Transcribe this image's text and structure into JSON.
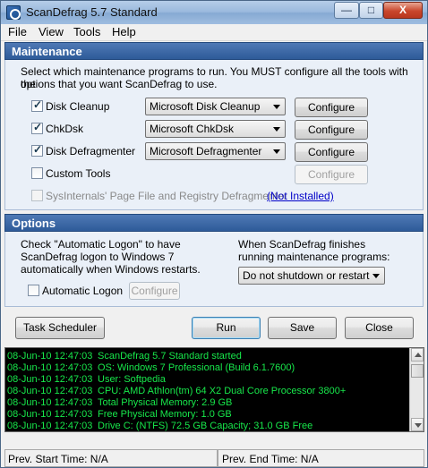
{
  "window": {
    "title": "ScanDefrag 5.7 Standard",
    "controls": {
      "minimize": "—",
      "maximize": "□",
      "close": "X"
    }
  },
  "menu": [
    "File",
    "View",
    "Tools",
    "Help"
  ],
  "maintenance": {
    "header": "Maintenance",
    "description_line1": "Select which maintenance programs to run.  You MUST configure all the tools with the",
    "description_line2": "options that you want ScanDefrag to use.",
    "tools": [
      {
        "label": "Disk Cleanup",
        "checked": true,
        "program": "Microsoft Disk Cleanup",
        "configure": "Configure"
      },
      {
        "label": "ChkDsk",
        "checked": true,
        "program": "Microsoft ChkDsk",
        "configure": "Configure"
      },
      {
        "label": "Disk Defragmenter",
        "checked": true,
        "program": "Microsoft Defragmenter",
        "configure": "Configure"
      },
      {
        "label": "Custom Tools",
        "checked": false,
        "configure": "Configure"
      }
    ],
    "sysinternals_label": "SysInternals' Page File and Registry Defragmenter",
    "not_installed_link": "(Not Installed)"
  },
  "options": {
    "header": "Options",
    "left_text_lines": [
      "Check \"Automatic Logon\" to have",
      "ScanDefrag logon to Windows 7",
      "automatically when Windows restarts."
    ],
    "automatic_logon_label": "Automatic Logon",
    "automatic_logon_checked": false,
    "configure_label": "Configure",
    "right_text_lines": [
      "When ScanDefrag finishes",
      "running maintenance programs:"
    ],
    "finish_action": "Do not shutdown or restart"
  },
  "actions": {
    "task_scheduler": "Task Scheduler",
    "run": "Run",
    "save": "Save",
    "close": "Close"
  },
  "log": [
    {
      "time": "08-Jun-10 12:47:03",
      "message": "ScanDefrag 5.7 Standard started"
    },
    {
      "time": "08-Jun-10 12:47:03",
      "message": "OS: Windows 7 Professional (Build 6.1.7600)"
    },
    {
      "time": "08-Jun-10 12:47:03",
      "message": "User: Softpedia"
    },
    {
      "time": "08-Jun-10 12:47:03",
      "message": "CPU: AMD Athlon(tm) 64 X2 Dual Core Processor 3800+"
    },
    {
      "time": "08-Jun-10 12:47:03",
      "message": "Total Physical Memory: 2.9 GB"
    },
    {
      "time": "08-Jun-10 12:47:03",
      "message": "Free Physical Memory: 1.0 GB"
    },
    {
      "time": "08-Jun-10 12:47:03",
      "message": "Drive C: (NTFS)  72.5 GB Capacity; 31.0 GB Free"
    }
  ],
  "status": {
    "prev_start": "Prev. Start Time: N/A",
    "prev_end": "Prev. End Time: N/A"
  },
  "colors": {
    "section_header": "#3a65a4",
    "log_background": "#000000",
    "log_text": "#17e84b",
    "link": "#0000c8"
  }
}
